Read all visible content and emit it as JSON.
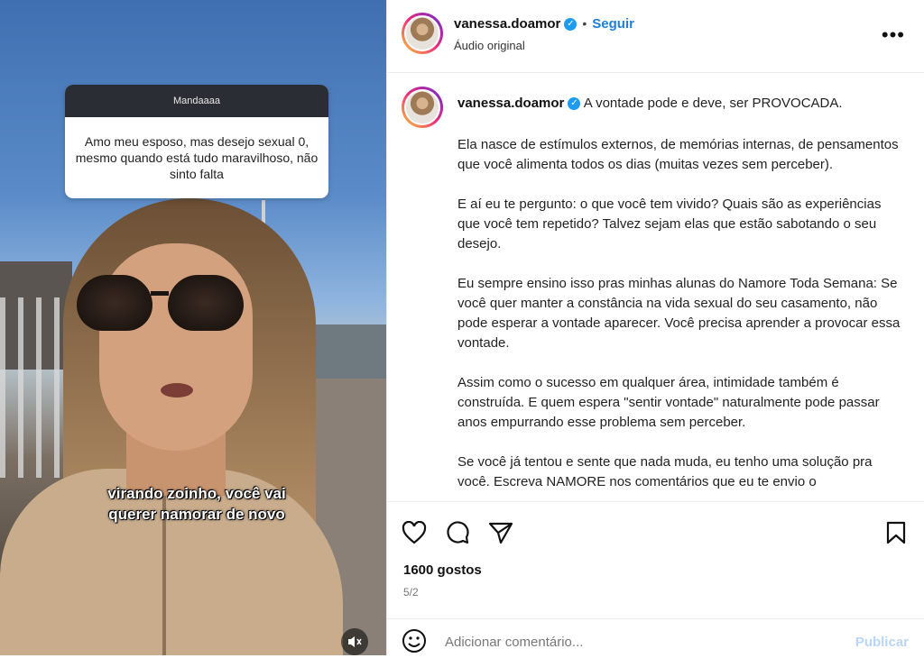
{
  "story": {
    "question_header": "Mandaaaa",
    "question_text": "Amo meu esposo, mas desejo sexual 0, mesmo quando está tudo maravilhoso, não sinto falta",
    "caption_line1": "virando zoinho, você vai",
    "caption_line2": "querer namorar de novo"
  },
  "post": {
    "username": "vanessa.doamor",
    "follow_label": "Seguir",
    "audio_label": "Áudio original",
    "caption_title": "A vontade pode e deve, ser PROVOCADA.",
    "paragraphs": [
      "Ela nasce de estímulos externos, de memórias internas, de pensamentos que você alimenta todos os dias (muitas vezes sem perceber).",
      "E aí eu te pergunto: o que você tem vivido? Quais são as experiências que você tem repetido? Talvez sejam elas que estão sabotando o seu desejo.",
      "Eu sempre ensino isso pras minhas alunas do Namore Toda Semana: Se você quer manter a constância na vida sexual do seu casamento, não pode esperar a vontade aparecer. Você precisa aprender a provocar essa vontade.",
      "Assim como o sucesso em qualquer área, intimidade também é construída. E quem espera \"sentir vontade\" naturalmente pode passar anos empurrando esse problema sem perceber.",
      "Se você já tentou e sente que nada muda, eu tenho uma solução pra você. Escreva NAMORE nos comentários que eu te envio o"
    ],
    "likes": "1600 gostos",
    "date": "5/2",
    "comment_placeholder": "Adicionar comentário...",
    "publish_label": "Publicar"
  },
  "icons": [
    "verified-badge-icon",
    "more-options-icon",
    "heart-icon",
    "comment-icon",
    "share-icon",
    "bookmark-icon",
    "emoji-icon",
    "sound-muted-icon"
  ]
}
